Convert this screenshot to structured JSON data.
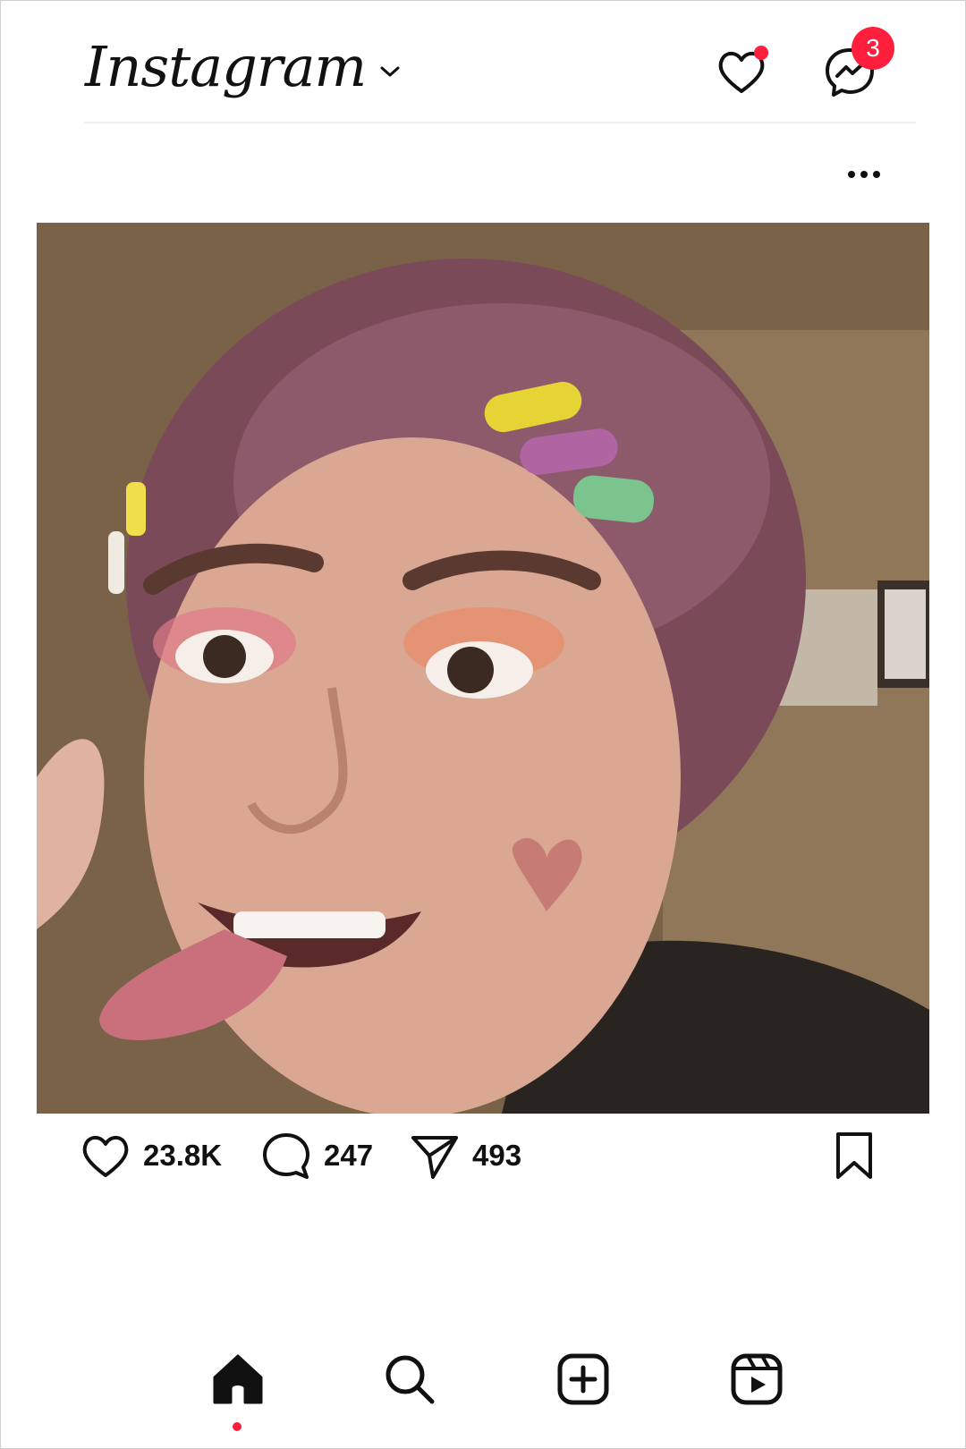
{
  "header": {
    "logo_text": "Instagram",
    "messages_badge": "3"
  },
  "post": {
    "image_alt": "Selfie of a person with pink hair and colorful hair clips sticking out their tongue",
    "likes": "23.8K",
    "comments": "247",
    "shares": "493"
  },
  "icons": {
    "header": [
      "chevron-down-icon",
      "heart-icon",
      "messenger-icon"
    ],
    "post": [
      "more-icon",
      "heart-icon",
      "comment-icon",
      "share-icon",
      "bookmark-icon"
    ],
    "nav": [
      "home-icon",
      "search-icon",
      "create-icon",
      "reels-icon"
    ]
  },
  "colors": {
    "accent_red": "#ff1f3d",
    "text": "#111111",
    "background": "#ffffff"
  }
}
